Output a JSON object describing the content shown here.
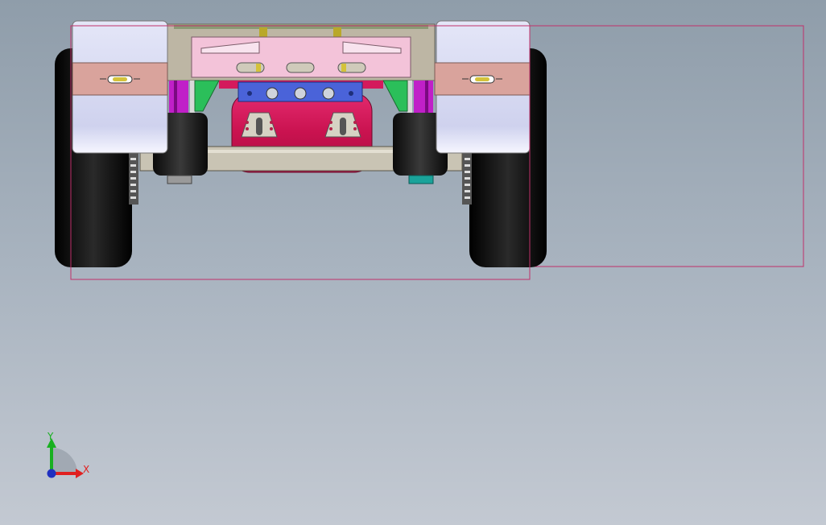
{
  "viewport": {
    "view": "front",
    "background": {
      "top": "#8f9daa",
      "bottom": "#c3c9d2"
    },
    "selection_box_color": "#c0306a"
  },
  "model": {
    "name": "trailer-axle-assembly",
    "colors": {
      "tire": "#111111",
      "fender": "#dfe2f5",
      "fender_band": "#d9a39c",
      "crossmember": "#f3c3d9",
      "frame": "#bdb6a4",
      "tank": "#d41a5c",
      "bracket_blue": "#4a63d9",
      "bracket_green": "#2bbf5a",
      "shock_magenta": "#c020c8",
      "air_spring": "#1e1e1e",
      "nut_teal": "#1aa39a"
    }
  },
  "triad": {
    "y_label": "Y",
    "x_label": "X",
    "y_color": "#18b020",
    "x_color": "#e02020",
    "z_color": "#2030c0"
  }
}
